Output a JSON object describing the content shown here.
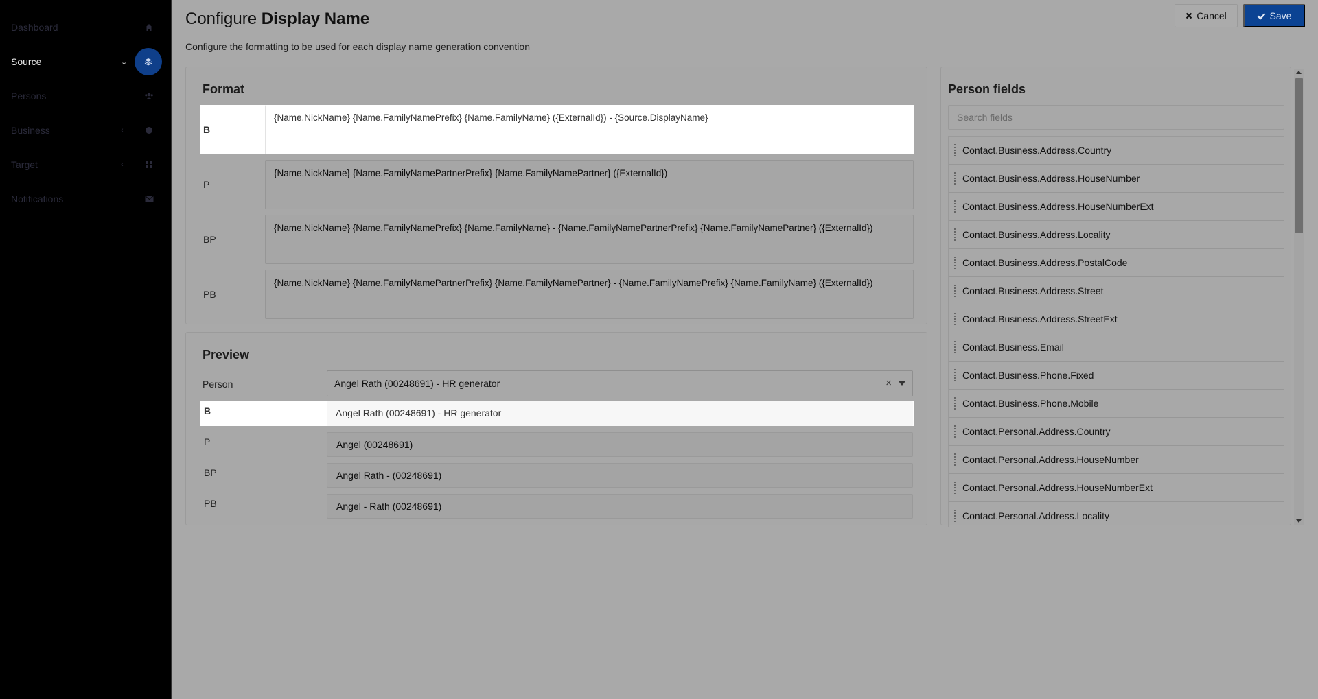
{
  "sidebar": {
    "items": [
      {
        "label": "Dashboard",
        "icon": "home-icon"
      },
      {
        "label": "Source",
        "icon": "layers-icon",
        "chevron": "⌄",
        "active": true
      },
      {
        "label": "Persons",
        "icon": "users-icon"
      },
      {
        "label": "Business",
        "icon": "globe-icon",
        "chevron": "‹"
      },
      {
        "label": "Target",
        "icon": "grid-icon",
        "chevron": "‹"
      },
      {
        "label": "Notifications",
        "icon": "envelope-icon"
      }
    ]
  },
  "header": {
    "title_prefix": "Configure ",
    "title_bold": "Display Name",
    "subtitle": "Configure the formatting to be used for each display name generation convention",
    "cancel_label": "Cancel",
    "save_label": "Save"
  },
  "format": {
    "title": "Format",
    "rows": [
      {
        "label": "B",
        "value": "{Name.NickName} {Name.FamilyNamePrefix} {Name.FamilyName} ({ExternalId}) - {Source.DisplayName}"
      },
      {
        "label": "P",
        "value": "{Name.NickName} {Name.FamilyNamePartnerPrefix} {Name.FamilyNamePartner} ({ExternalId})"
      },
      {
        "label": "BP",
        "value": "{Name.NickName} {Name.FamilyNamePrefix} {Name.FamilyName} - {Name.FamilyNamePartnerPrefix} {Name.FamilyNamePartner} ({ExternalId})"
      },
      {
        "label": "PB",
        "value": "{Name.NickName} {Name.FamilyNamePartnerPrefix} {Name.FamilyNamePartner} - {Name.FamilyNamePrefix} {Name.FamilyName} ({ExternalId})"
      }
    ]
  },
  "preview": {
    "title": "Preview",
    "person_label": "Person",
    "person_value": "Angel Rath (00248691) - HR generator",
    "clear_glyph": "×",
    "rows": [
      {
        "label": "B",
        "value": "Angel Rath (00248691) - HR generator"
      },
      {
        "label": "P",
        "value": "Angel (00248691)"
      },
      {
        "label": "BP",
        "value": "Angel Rath - (00248691)"
      },
      {
        "label": "PB",
        "value": "Angel - Rath (00248691)"
      }
    ]
  },
  "person_fields": {
    "title": "Person fields",
    "search_placeholder": "Search fields",
    "items": [
      "Contact.Business.Address.Country",
      "Contact.Business.Address.HouseNumber",
      "Contact.Business.Address.HouseNumberExt",
      "Contact.Business.Address.Locality",
      "Contact.Business.Address.PostalCode",
      "Contact.Business.Address.Street",
      "Contact.Business.Address.StreetExt",
      "Contact.Business.Email",
      "Contact.Business.Phone.Fixed",
      "Contact.Business.Phone.Mobile",
      "Contact.Personal.Address.Country",
      "Contact.Personal.Address.HouseNumber",
      "Contact.Personal.Address.HouseNumberExt",
      "Contact.Personal.Address.Locality"
    ]
  },
  "colors": {
    "overlay": "#a9a9a9",
    "sidebar_bg": "#000000",
    "accent": "#0b4393"
  }
}
